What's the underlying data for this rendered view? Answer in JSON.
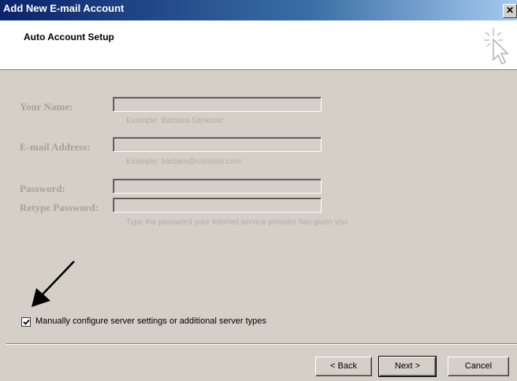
{
  "window": {
    "title": "Add New E-mail Account",
    "close_glyph": "✕"
  },
  "header": {
    "title": "Auto Account Setup",
    "icon": "cursor-sparkle-icon"
  },
  "form": {
    "your_name": {
      "label": "Your Name:",
      "value": "",
      "hint": "Example: Barbara Sankovic"
    },
    "email": {
      "label": "E-mail Address:",
      "value": "",
      "hint": "Example: barbara@contoso.com"
    },
    "password": {
      "label": "Password:",
      "value": ""
    },
    "retype_password": {
      "label": "Retype Password:",
      "value": "",
      "hint": "Type the password your Internet service provider has given you."
    }
  },
  "manual_config": {
    "label": "Manually configure server settings or additional server types",
    "checked": true
  },
  "buttons": {
    "back": "< Back",
    "next": "Next >",
    "cancel": "Cancel"
  },
  "colors": {
    "title_bar": "#0a246a",
    "dialog_bg": "#d4d0c8",
    "disabled_text": "#a5a29a"
  }
}
